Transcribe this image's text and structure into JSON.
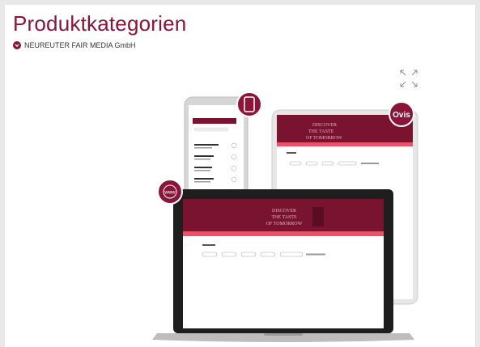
{
  "page": {
    "title": "Produktkategorien"
  },
  "company": {
    "name": "NEUREUTER FAIR MEDIA GmbH"
  },
  "icons": {
    "expand": "expand-arrows-icon",
    "phone": "smartphone-icon",
    "www": "www-globe-icon",
    "ovis": "ovis-logo",
    "company_toggle": "chevron-down-circle-icon"
  },
  "badges": {
    "ovis_text": "Ovis"
  },
  "colors": {
    "brand": "#8a1538",
    "accent": "#e8536a",
    "badge_accent": "#f5a623"
  }
}
